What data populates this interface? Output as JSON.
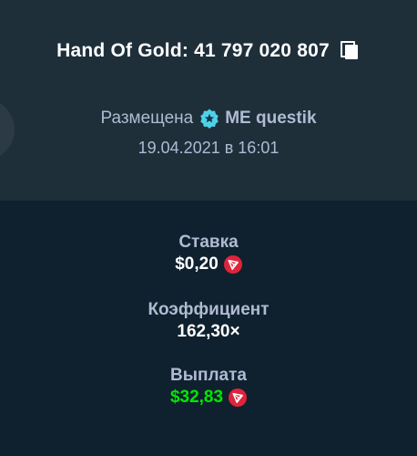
{
  "header": {
    "title": "Hand Of Gold: 41 797 020 807"
  },
  "bet_info": {
    "placed_label": "Размещена",
    "username": "ME questik",
    "datetime": "19.04.2021 в 16:01"
  },
  "stats": {
    "bet_label": "Ставка",
    "bet_value": "$0,20",
    "multiplier_label": "Коэффициент",
    "multiplier_value": "162,30×",
    "payout_label": "Выплата",
    "payout_value": "$32,83"
  },
  "icons": {
    "copy": "copy-icon",
    "vip": "star-badge-icon",
    "currency": "tron-coin-icon"
  },
  "colors": {
    "background": "#1a2c38",
    "panel_bottom": "#0f212e",
    "text_muted": "#b1bad3",
    "payout_green": "#00e701",
    "coin_red": "#e0233c",
    "badge_cyan": "#4fd1e8"
  }
}
